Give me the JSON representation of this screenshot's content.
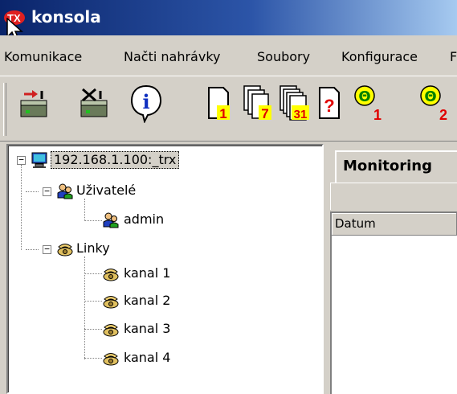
{
  "window": {
    "title": "konsola",
    "logo_text": "TX"
  },
  "menu": {
    "items": [
      "Komunikace",
      "Načti nahrávky",
      "Soubory",
      "Konfigurace",
      "F"
    ]
  },
  "toolbar": {
    "buttons": [
      {
        "icon": "connect-icon"
      },
      {
        "icon": "disconnect-icon"
      },
      {
        "icon": "info-icon",
        "glyph": "i"
      },
      {
        "icon": "page-1-icon",
        "label": "1"
      },
      {
        "icon": "pages-7-icon",
        "label": "7"
      },
      {
        "icon": "pages-31-icon",
        "label": "31"
      },
      {
        "icon": "page-question-icon",
        "glyph": "?"
      },
      {
        "icon": "timer-1-icon",
        "glyph": "Θ",
        "label": "1"
      },
      {
        "icon": "timer-2-icon",
        "glyph": "Θ",
        "label": "2"
      }
    ]
  },
  "tree": {
    "root": {
      "label": "192.168.1.100:_trx",
      "expander": "−"
    },
    "users": {
      "label": "Uživatelé",
      "expander": "−"
    },
    "admin": {
      "label": "admin"
    },
    "lines": {
      "label": "Linky",
      "expander": "−"
    },
    "channels": [
      "kanal 1",
      "kanal 2",
      "kanal 3",
      "kanal 4"
    ]
  },
  "right_panel": {
    "tab_label": "Monitoring",
    "column_header": "Datum"
  },
  "colors": {
    "title_start": "#0a246a",
    "title_end": "#a6caf0",
    "face": "#d4d0c8"
  }
}
